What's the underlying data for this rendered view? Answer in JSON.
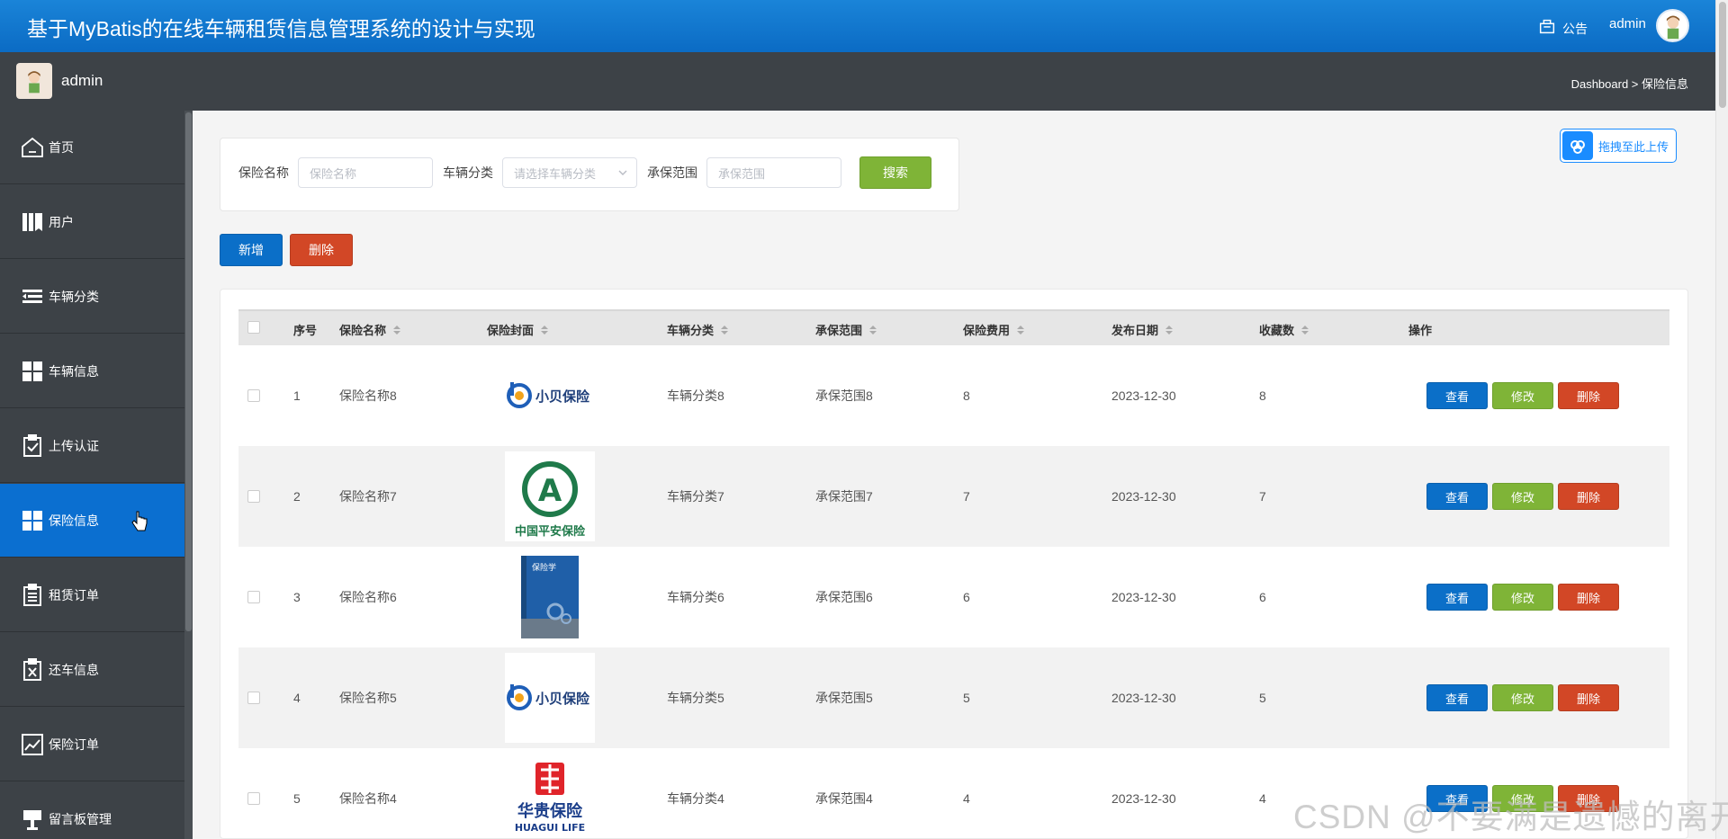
{
  "header": {
    "title": "基于MyBatis的在线车辆租赁信息管理系统的设计与实现",
    "notice_label": "公告",
    "username": "admin"
  },
  "subbar": {
    "username": "admin",
    "breadcrumb": "Dashboard > 保险信息"
  },
  "sidebar": {
    "items": [
      {
        "label": "首页",
        "icon": "home-icon"
      },
      {
        "label": "用户",
        "icon": "book-icon"
      },
      {
        "label": "车辆分类",
        "icon": "list-indent-icon"
      },
      {
        "label": "车辆信息",
        "icon": "grid-icon"
      },
      {
        "label": "上传认证",
        "icon": "clipboard-check-icon"
      },
      {
        "label": "保险信息",
        "icon": "grid-icon",
        "active": true
      },
      {
        "label": "租赁订单",
        "icon": "clipboard-list-icon"
      },
      {
        "label": "还车信息",
        "icon": "clipboard-x-icon"
      },
      {
        "label": "保险订单",
        "icon": "trend-chart-icon"
      },
      {
        "label": "留言板管理",
        "icon": "podium-icon"
      }
    ]
  },
  "upload": {
    "label": "拖拽至此上传"
  },
  "search": {
    "name_label": "保险名称",
    "name_placeholder": "保险名称",
    "category_label": "车辆分类",
    "category_placeholder": "请选择车辆分类",
    "scope_label": "承保范围",
    "scope_placeholder": "承保范围",
    "button": "搜索"
  },
  "toolbar": {
    "add": "新增",
    "delete": "删除"
  },
  "table": {
    "columns": [
      "序号",
      "保险名称",
      "保险封面",
      "车辆分类",
      "承保范围",
      "保险费用",
      "发布日期",
      "收藏数",
      "操作"
    ],
    "actions": {
      "view": "查看",
      "edit": "修改",
      "delete": "删除"
    },
    "rows": [
      {
        "index": "1",
        "name": "保险名称8",
        "cover": "小贝保险",
        "category": "车辆分类8",
        "scope": "承保范围8",
        "fee": "8",
        "date": "2023-12-30",
        "favorites": "8"
      },
      {
        "index": "2",
        "name": "保险名称7",
        "cover": "中国平安保险",
        "category": "车辆分类7",
        "scope": "承保范围7",
        "fee": "7",
        "date": "2023-12-30",
        "favorites": "7"
      },
      {
        "index": "3",
        "name": "保险名称6",
        "cover": "保险学",
        "category": "车辆分类6",
        "scope": "承保范围6",
        "fee": "6",
        "date": "2023-12-30",
        "favorites": "6"
      },
      {
        "index": "4",
        "name": "保险名称5",
        "cover": "小贝保险",
        "category": "车辆分类5",
        "scope": "承保范围5",
        "fee": "5",
        "date": "2023-12-30",
        "favorites": "5"
      },
      {
        "index": "5",
        "name": "保险名称4",
        "cover": "华贵保险",
        "cover_sub": "HUAGUI LIFE",
        "category": "车辆分类4",
        "scope": "承保范围4",
        "fee": "4",
        "date": "2023-12-30",
        "favorites": "4"
      }
    ]
  },
  "watermark": "CSDN @不要满是遗憾的离开",
  "colors": {
    "primary": "#0b6fc8",
    "success": "#7fb437",
    "danger": "#d24726",
    "sidebar": "#3d4247"
  }
}
